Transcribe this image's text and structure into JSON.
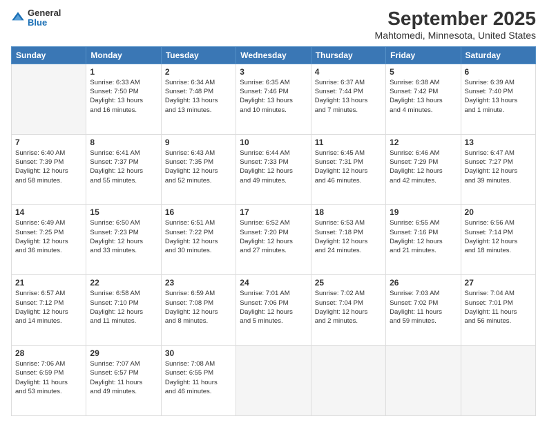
{
  "header": {
    "logo_line1": "General",
    "logo_line2": "Blue",
    "title": "September 2025",
    "subtitle": "Mahtomedi, Minnesota, United States"
  },
  "days_of_week": [
    "Sunday",
    "Monday",
    "Tuesday",
    "Wednesday",
    "Thursday",
    "Friday",
    "Saturday"
  ],
  "weeks": [
    [
      {
        "num": "",
        "info": ""
      },
      {
        "num": "1",
        "info": "Sunrise: 6:33 AM\nSunset: 7:50 PM\nDaylight: 13 hours\nand 16 minutes."
      },
      {
        "num": "2",
        "info": "Sunrise: 6:34 AM\nSunset: 7:48 PM\nDaylight: 13 hours\nand 13 minutes."
      },
      {
        "num": "3",
        "info": "Sunrise: 6:35 AM\nSunset: 7:46 PM\nDaylight: 13 hours\nand 10 minutes."
      },
      {
        "num": "4",
        "info": "Sunrise: 6:37 AM\nSunset: 7:44 PM\nDaylight: 13 hours\nand 7 minutes."
      },
      {
        "num": "5",
        "info": "Sunrise: 6:38 AM\nSunset: 7:42 PM\nDaylight: 13 hours\nand 4 minutes."
      },
      {
        "num": "6",
        "info": "Sunrise: 6:39 AM\nSunset: 7:40 PM\nDaylight: 13 hours\nand 1 minute."
      }
    ],
    [
      {
        "num": "7",
        "info": "Sunrise: 6:40 AM\nSunset: 7:39 PM\nDaylight: 12 hours\nand 58 minutes."
      },
      {
        "num": "8",
        "info": "Sunrise: 6:41 AM\nSunset: 7:37 PM\nDaylight: 12 hours\nand 55 minutes."
      },
      {
        "num": "9",
        "info": "Sunrise: 6:43 AM\nSunset: 7:35 PM\nDaylight: 12 hours\nand 52 minutes."
      },
      {
        "num": "10",
        "info": "Sunrise: 6:44 AM\nSunset: 7:33 PM\nDaylight: 12 hours\nand 49 minutes."
      },
      {
        "num": "11",
        "info": "Sunrise: 6:45 AM\nSunset: 7:31 PM\nDaylight: 12 hours\nand 46 minutes."
      },
      {
        "num": "12",
        "info": "Sunrise: 6:46 AM\nSunset: 7:29 PM\nDaylight: 12 hours\nand 42 minutes."
      },
      {
        "num": "13",
        "info": "Sunrise: 6:47 AM\nSunset: 7:27 PM\nDaylight: 12 hours\nand 39 minutes."
      }
    ],
    [
      {
        "num": "14",
        "info": "Sunrise: 6:49 AM\nSunset: 7:25 PM\nDaylight: 12 hours\nand 36 minutes."
      },
      {
        "num": "15",
        "info": "Sunrise: 6:50 AM\nSunset: 7:23 PM\nDaylight: 12 hours\nand 33 minutes."
      },
      {
        "num": "16",
        "info": "Sunrise: 6:51 AM\nSunset: 7:22 PM\nDaylight: 12 hours\nand 30 minutes."
      },
      {
        "num": "17",
        "info": "Sunrise: 6:52 AM\nSunset: 7:20 PM\nDaylight: 12 hours\nand 27 minutes."
      },
      {
        "num": "18",
        "info": "Sunrise: 6:53 AM\nSunset: 7:18 PM\nDaylight: 12 hours\nand 24 minutes."
      },
      {
        "num": "19",
        "info": "Sunrise: 6:55 AM\nSunset: 7:16 PM\nDaylight: 12 hours\nand 21 minutes."
      },
      {
        "num": "20",
        "info": "Sunrise: 6:56 AM\nSunset: 7:14 PM\nDaylight: 12 hours\nand 18 minutes."
      }
    ],
    [
      {
        "num": "21",
        "info": "Sunrise: 6:57 AM\nSunset: 7:12 PM\nDaylight: 12 hours\nand 14 minutes."
      },
      {
        "num": "22",
        "info": "Sunrise: 6:58 AM\nSunset: 7:10 PM\nDaylight: 12 hours\nand 11 minutes."
      },
      {
        "num": "23",
        "info": "Sunrise: 6:59 AM\nSunset: 7:08 PM\nDaylight: 12 hours\nand 8 minutes."
      },
      {
        "num": "24",
        "info": "Sunrise: 7:01 AM\nSunset: 7:06 PM\nDaylight: 12 hours\nand 5 minutes."
      },
      {
        "num": "25",
        "info": "Sunrise: 7:02 AM\nSunset: 7:04 PM\nDaylight: 12 hours\nand 2 minutes."
      },
      {
        "num": "26",
        "info": "Sunrise: 7:03 AM\nSunset: 7:02 PM\nDaylight: 11 hours\nand 59 minutes."
      },
      {
        "num": "27",
        "info": "Sunrise: 7:04 AM\nSunset: 7:01 PM\nDaylight: 11 hours\nand 56 minutes."
      }
    ],
    [
      {
        "num": "28",
        "info": "Sunrise: 7:06 AM\nSunset: 6:59 PM\nDaylight: 11 hours\nand 53 minutes."
      },
      {
        "num": "29",
        "info": "Sunrise: 7:07 AM\nSunset: 6:57 PM\nDaylight: 11 hours\nand 49 minutes."
      },
      {
        "num": "30",
        "info": "Sunrise: 7:08 AM\nSunset: 6:55 PM\nDaylight: 11 hours\nand 46 minutes."
      },
      {
        "num": "",
        "info": ""
      },
      {
        "num": "",
        "info": ""
      },
      {
        "num": "",
        "info": ""
      },
      {
        "num": "",
        "info": ""
      }
    ]
  ]
}
